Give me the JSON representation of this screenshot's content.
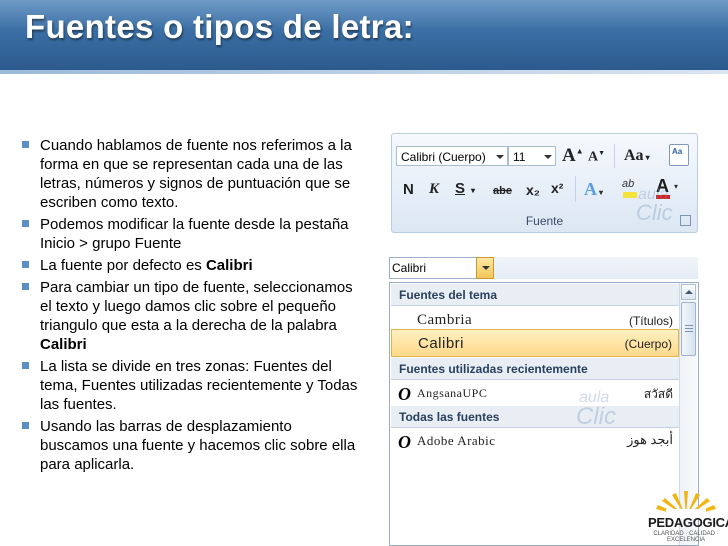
{
  "slide": {
    "title": "Fuentes o tipos de letra:",
    "bullets": [
      {
        "parts": [
          {
            "text": "Cuando hablamos de fuente nos referimos a la forma en que se representan cada una de las letras, números y signos de puntuación que se escriben como texto.",
            "bold": false
          }
        ]
      },
      {
        "parts": [
          {
            "text": "Podemos modificar la fuente desde la pestaña Inicio > grupo Fuente",
            "bold": false
          }
        ]
      },
      {
        "parts": [
          {
            "text": "La fuente por defecto es ",
            "bold": false
          },
          {
            "text": "Calibri",
            "bold": true
          }
        ]
      },
      {
        "parts": [
          {
            "text": "Para cambiar un tipo de fuente, seleccionamos el texto y luego damos clic sobre el pequeño triangulo que esta a la derecha de la palabra ",
            "bold": false
          },
          {
            "text": "Calibri",
            "bold": true
          }
        ]
      },
      {
        "parts": [
          {
            "text": "La lista se divide en tres zonas: Fuentes del tema, Fuentes utilizadas recientemente y Todas las fuentes.",
            "bold": false
          }
        ]
      },
      {
        "parts": [
          {
            "text": "Usando las barras de desplazamiento buscamos una fuente y hacemos clic sobre ella para aplicarla.",
            "bold": false
          }
        ]
      }
    ]
  },
  "ribbon": {
    "font_name": "Calibri (Cuerpo)",
    "font_size": "11",
    "grow_label": "A",
    "shrink_label": "A",
    "change_case_label": "Aa",
    "bold_label": "N",
    "italic_label": "K",
    "underline_label": "S",
    "strike_label": "abe",
    "subscript_label": "x₂",
    "superscript_label": "x²",
    "highlight_label": "ab",
    "font_color_label": "A",
    "group_label": "Fuente",
    "watermark_top": "aula",
    "watermark_bottom": "Clic"
  },
  "font_dropdown": {
    "combo_value": "Calibri",
    "sections": [
      {
        "label": "Fuentes del tema"
      },
      {
        "label": "Fuentes utilizadas recientemente"
      },
      {
        "label": "Todas las fuentes"
      }
    ],
    "theme_fonts": [
      {
        "name": "Cambria",
        "tag": "(Títulos)",
        "selected": false
      },
      {
        "name": "Calibri",
        "tag": "(Cuerpo)",
        "selected": true
      }
    ],
    "recent_fonts": [
      {
        "name": "AngsanaUPC",
        "sample": "สวัสดี"
      }
    ],
    "all_fonts": [
      {
        "name": "Adobe Arabic",
        "sample": "أبجد هوز"
      }
    ],
    "watermark_top": "aula",
    "watermark_bottom": "Clic"
  },
  "logo": {
    "name": "PEDAGOGICA",
    "tagline": "CLARIDAD · CALIDAD · EXCELENCIA"
  },
  "colors": {
    "title_bar": "#3a6ea4",
    "bullet": "#5b8fc4",
    "selected_item": "#ffd98a",
    "font_color_red": "#d42020",
    "highlight_yellow": "#f5e33c"
  }
}
